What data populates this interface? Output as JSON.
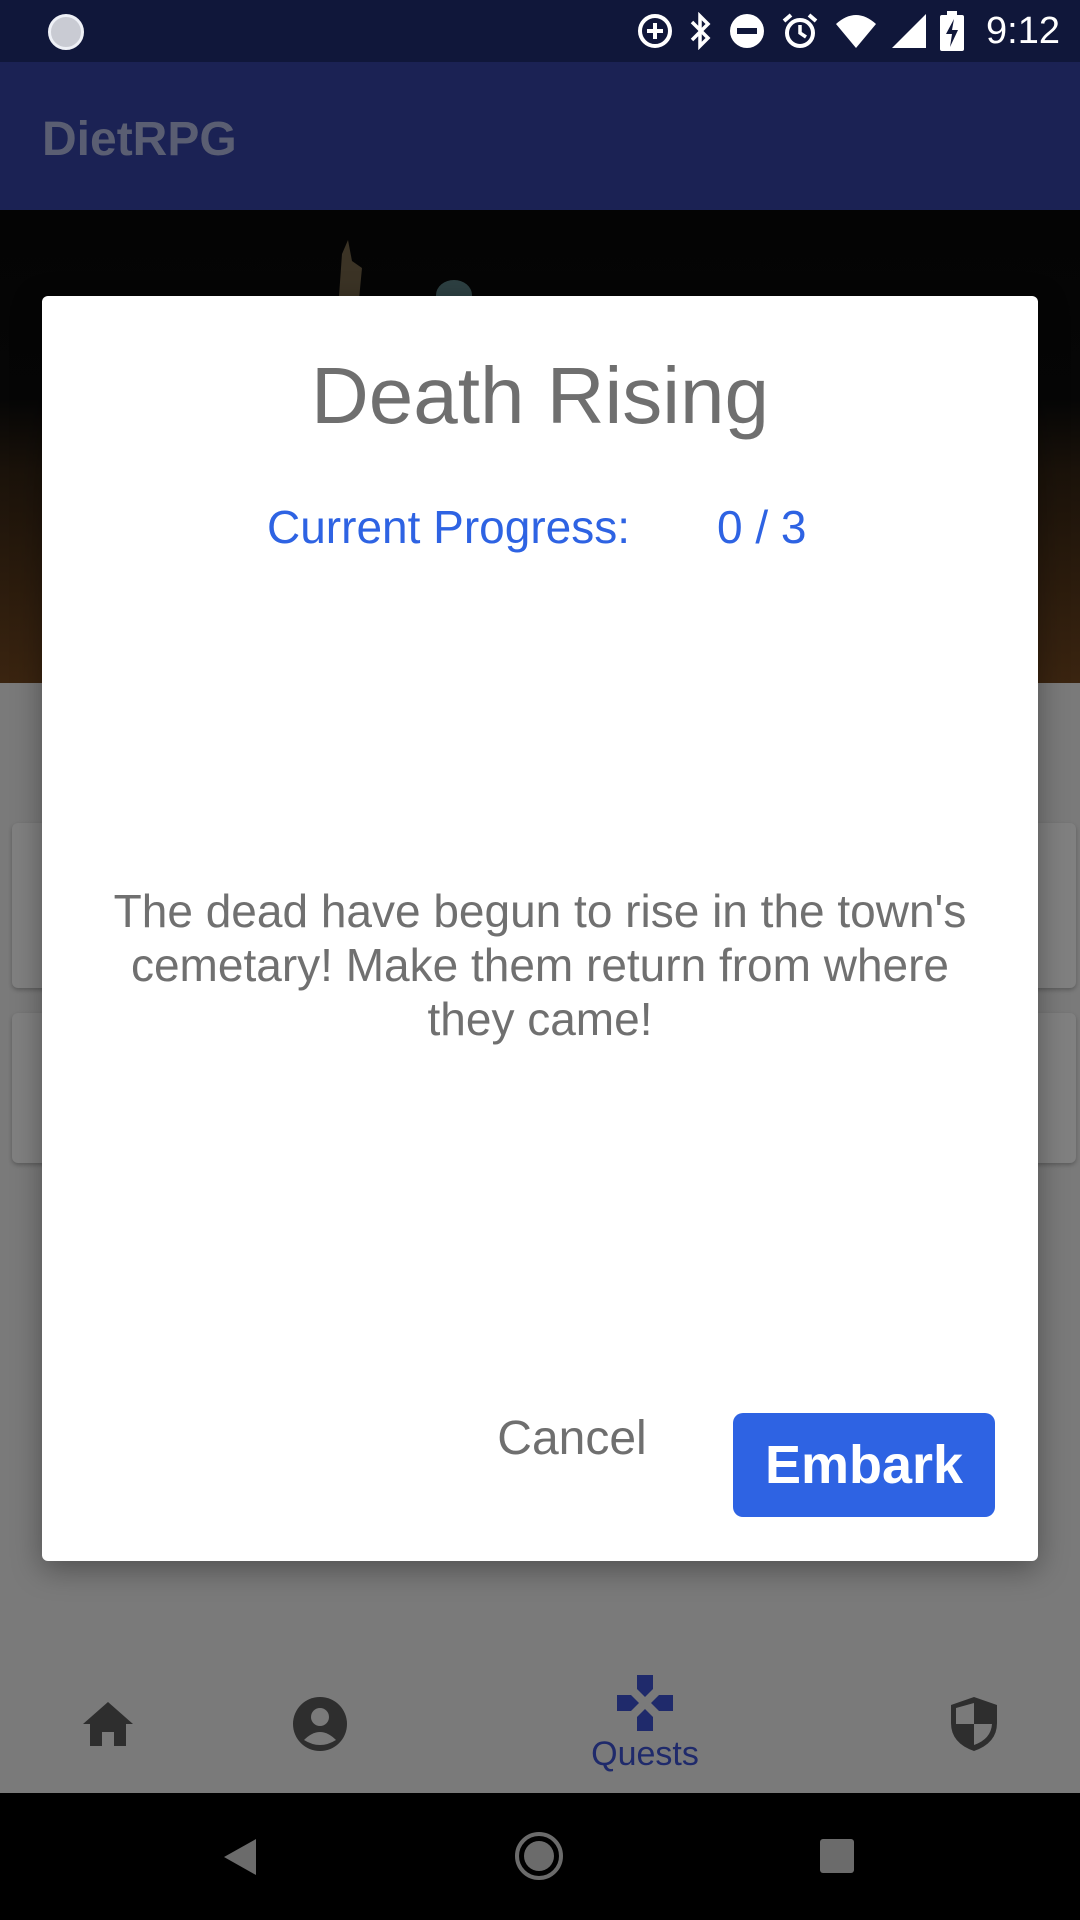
{
  "status_bar": {
    "time": "9:12",
    "icons": [
      "data-saver-icon",
      "bluetooth-icon",
      "do-not-disturb-icon",
      "alarm-icon",
      "wifi-icon",
      "cell-signal-icon",
      "battery-charging-icon"
    ]
  },
  "app_bar": {
    "title": "DietRPG"
  },
  "dialog": {
    "title": "Death Rising",
    "progress_label": "Current Progress:",
    "progress_value": "0 / 3",
    "description": "The dead have begun to rise in the town's cemetary! Make them return from where they came!",
    "cancel_label": "Cancel",
    "embark_label": "Embark"
  },
  "bottom_nav": {
    "items": [
      {
        "icon": "home-icon",
        "label": ""
      },
      {
        "icon": "account-circle-icon",
        "label": ""
      },
      {
        "icon": "gamepad-icon",
        "label": "Quests",
        "active": true
      },
      {
        "icon": "shield-icon",
        "label": ""
      }
    ]
  },
  "colors": {
    "status_bar": "#10173a",
    "app_bar": "#1b2254",
    "accent": "#2e63e3",
    "scrim": "#7a7a7a",
    "nav_active": "#1f2a6b"
  }
}
